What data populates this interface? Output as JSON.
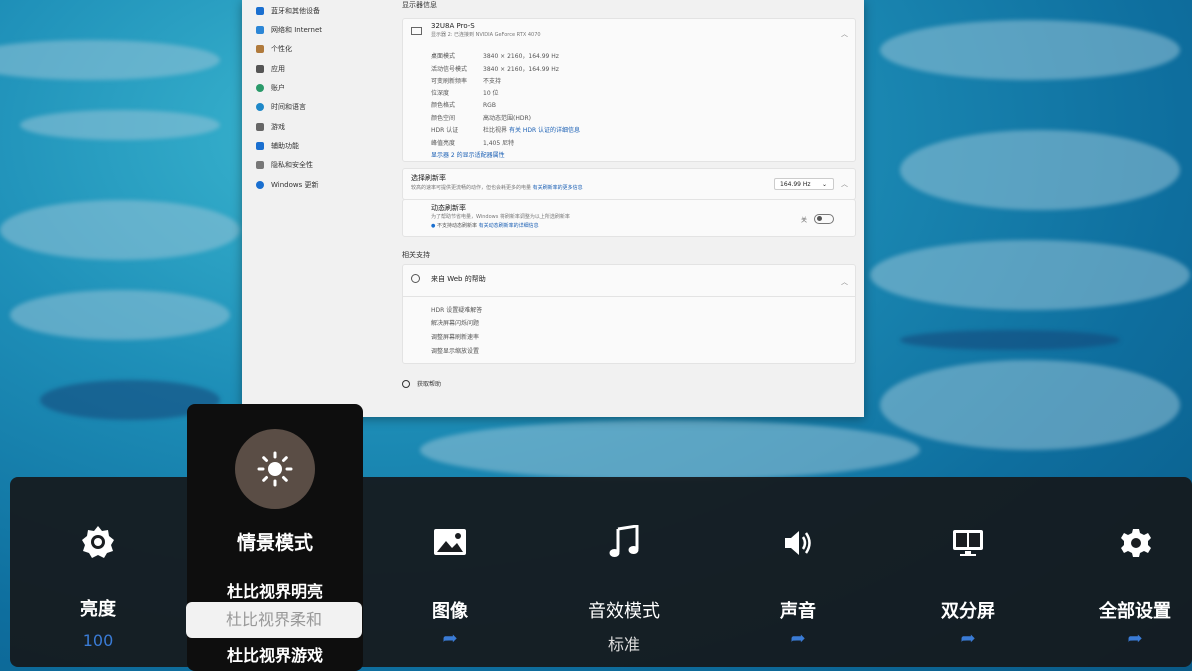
{
  "nav": {
    "items": [
      {
        "label": "蓝牙和其他设备",
        "icon": "bluetooth-icon"
      },
      {
        "label": "网络和 Internet",
        "icon": "wifi-icon"
      },
      {
        "label": "个性化",
        "icon": "brush-icon"
      },
      {
        "label": "应用",
        "icon": "apps-icon"
      },
      {
        "label": "账户",
        "icon": "account-icon"
      },
      {
        "label": "时间和语言",
        "icon": "globe-clock-icon"
      },
      {
        "label": "游戏",
        "icon": "gamepad-icon"
      },
      {
        "label": "辅助功能",
        "icon": "accessibility-icon"
      },
      {
        "label": "隐私和安全性",
        "icon": "shield-icon"
      },
      {
        "label": "Windows 更新",
        "icon": "update-icon"
      }
    ]
  },
  "display_info": {
    "section_title": "显示器信息",
    "monitor_name": "32U8A Pro-S",
    "monitor_sub": "显示器 2: 已连接到 NVIDIA GeForce RTX 4070",
    "rows": [
      {
        "k": "桌面模式",
        "v": "3840 × 2160，164.99 Hz"
      },
      {
        "k": "活动信号模式",
        "v": "3840 × 2160，164.99 Hz"
      },
      {
        "k": "可变刷新频率",
        "v": "不支持"
      },
      {
        "k": "位深度",
        "v": "10 位"
      },
      {
        "k": "颜色格式",
        "v": "RGB"
      },
      {
        "k": "颜色空间",
        "v": "高动态范围(HDR)"
      },
      {
        "k": "HDR 认证",
        "v": "杜比视界"
      },
      {
        "k": "峰值亮度",
        "v": "1,405 尼特"
      }
    ],
    "hdr_link": "有关 HDR 认证的详细信息",
    "adapter_link": "显示器 2 的显示适配器属性"
  },
  "refresh": {
    "title": "选择刷新率",
    "desc": "较高的速率可提供更流畅的动作，但也会耗更多的电量",
    "link": "有关刷新率的更多信息",
    "value": "164.99 Hz"
  },
  "dynamic": {
    "title": "动态刷新率",
    "desc": "为了帮助节省电量，Windows 将刷新率调整为以上所选刷新率",
    "note": "不支持动态刷新率",
    "note_link": "有关动态刷新率的详细信息",
    "toggle_label": "关"
  },
  "support": {
    "section_title": "相关支持",
    "header": "来自 Web 的帮助",
    "links": [
      "HDR 设置疑难解答",
      "解决屏幕闪烁问题",
      "调整屏幕刷新速率",
      "调整显示缩放设置"
    ],
    "get_help": "获取帮助"
  },
  "osd": {
    "items": [
      {
        "label": "亮度",
        "value": "100",
        "icon": "sun-gear-icon"
      },
      {
        "label": "情景模式",
        "icon": "sun-icon"
      },
      {
        "label": "图像",
        "icon": "image-icon"
      },
      {
        "label": "音效模式",
        "value": "标准",
        "icon": "music-note-icon"
      },
      {
        "label": "声音",
        "icon": "speaker-icon"
      },
      {
        "label": "双分屏",
        "icon": "dual-screen-icon"
      },
      {
        "label": "全部设置",
        "icon": "gear-icon"
      }
    ],
    "submenu": [
      "杜比视界明亮",
      "杜比视界柔和",
      "杜比视界游戏"
    ],
    "accent": "#3a7bd5"
  }
}
